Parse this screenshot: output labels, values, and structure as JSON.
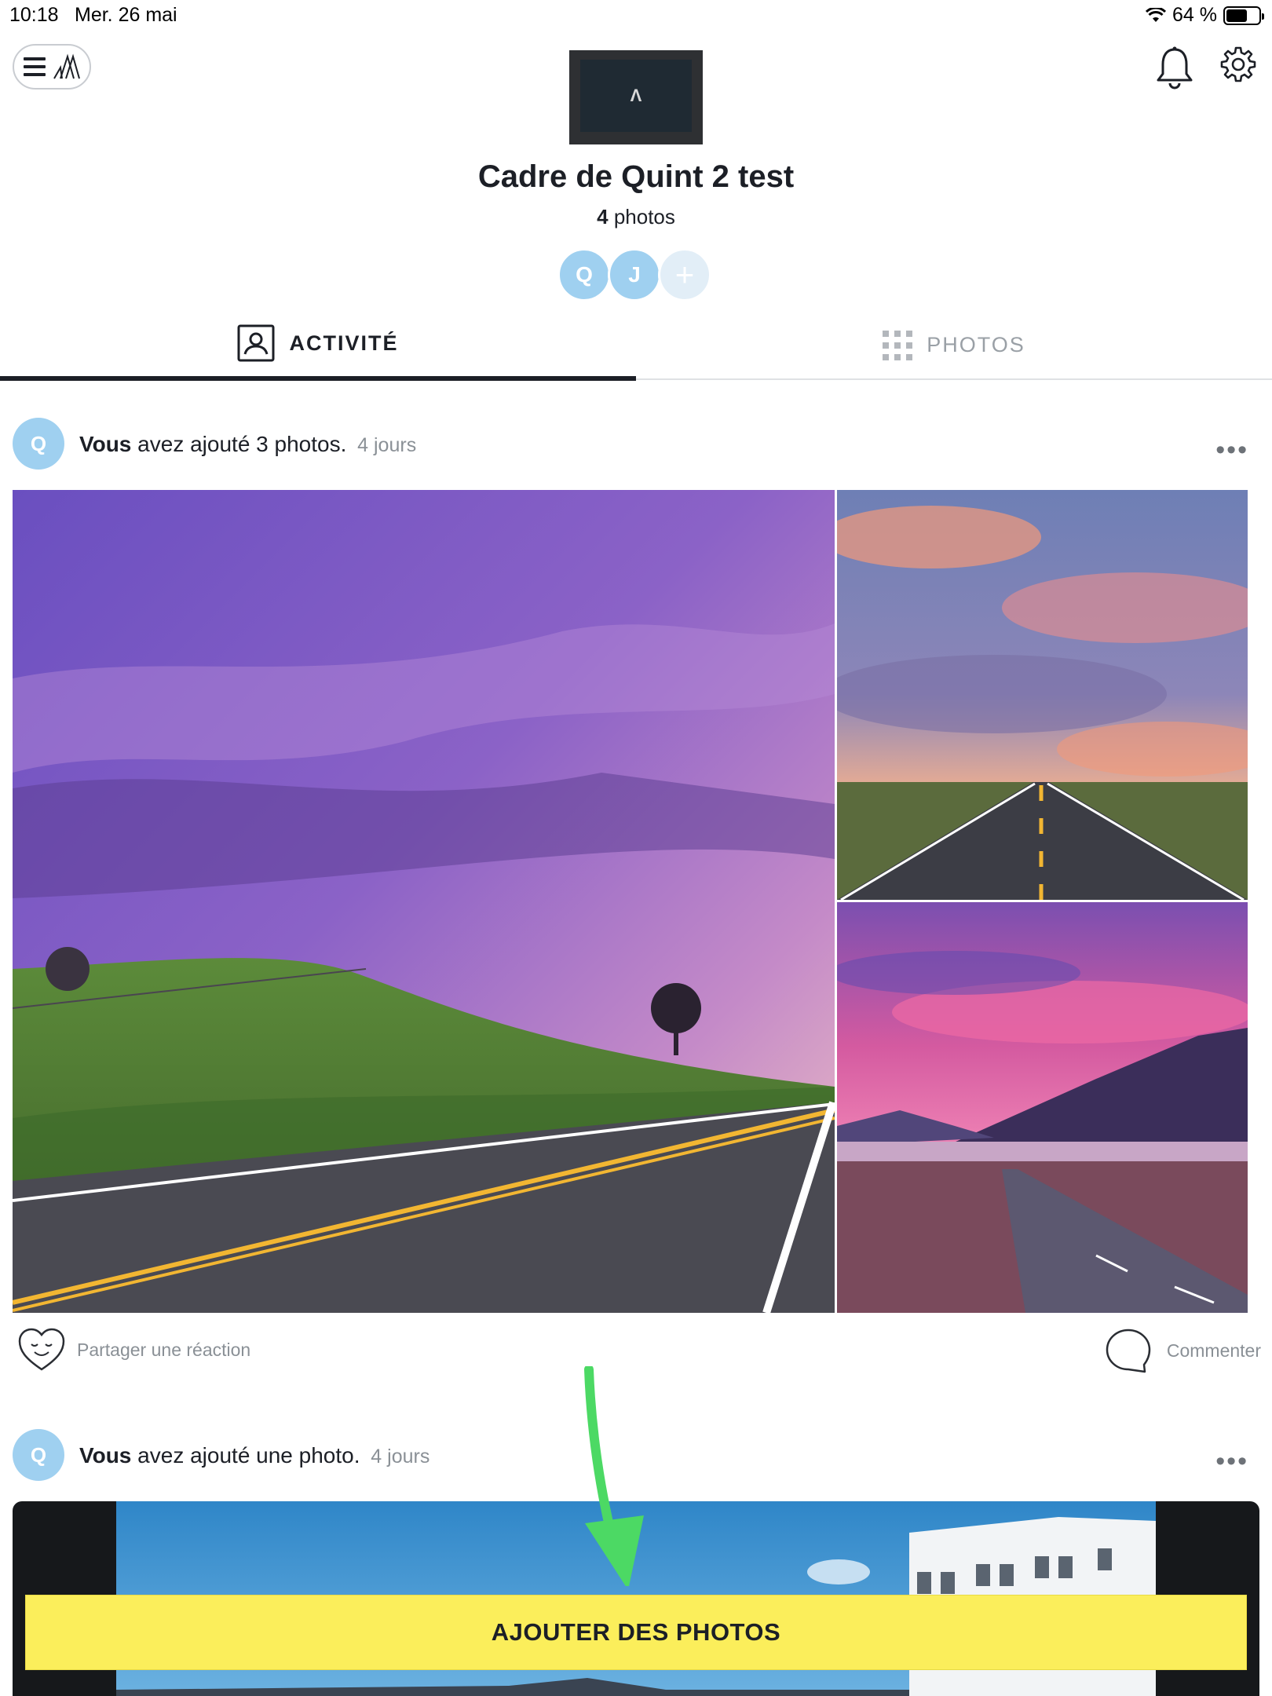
{
  "status": {
    "time": "10:18",
    "date": "Mer. 26 mai",
    "battery": "64 %",
    "battery_level": 0.64
  },
  "frame": {
    "logo": "Λ",
    "title": "Cadre de Quint 2 test",
    "photo_count": "4",
    "photo_label": "photos"
  },
  "members": [
    {
      "initial": "Q"
    },
    {
      "initial": "J"
    }
  ],
  "members_add": "+",
  "tabs": {
    "activity": "ACTIVITÉ",
    "photos": "PHOTOS"
  },
  "posts": [
    {
      "avatar": "Q",
      "who": "Vous",
      "action": "avez ajouté 3 photos.",
      "when": "4 jours",
      "more": "•••"
    },
    {
      "avatar": "Q",
      "who": "Vous",
      "action": "avez ajouté une photo.",
      "when": "4 jours",
      "more": "•••"
    }
  ],
  "reactions": {
    "share": "Partager une réaction",
    "comment": "Commenter"
  },
  "cta": {
    "add_photos": "AJOUTER DES PHOTOS"
  },
  "colors": {
    "accent": "#fbee5b",
    "avatar": "#9fd0f0",
    "arrow": "#4cd964",
    "text": "#1c1f26",
    "muted": "#8a9096"
  }
}
